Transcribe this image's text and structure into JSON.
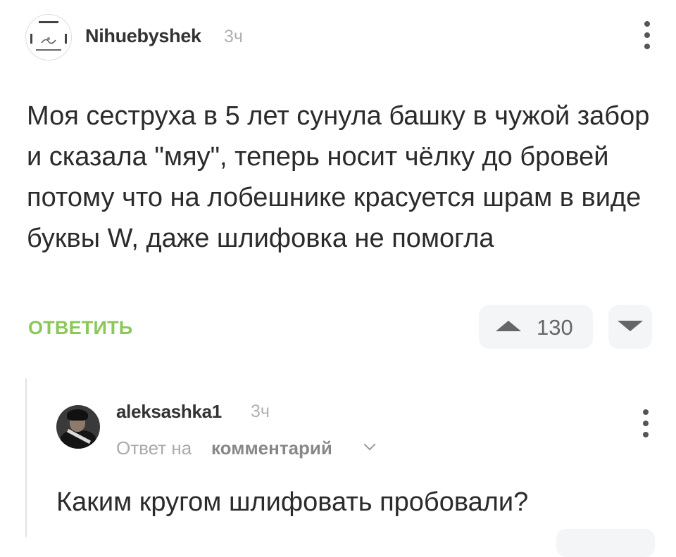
{
  "comment": {
    "username": "Nihuebyshek",
    "time": "3ч",
    "text": "Моя сеструха в 5 лет сунула башку в чужой забор и сказала \"мяу\", теперь носит чёлку до бровей потому что на лобешнике красуется шрам в виде буквы W, даже шлифовка не помогла",
    "reply_label": "ОТВЕТИТЬ",
    "rating": "130"
  },
  "reply": {
    "username": "aleksashka1",
    "time": "3ч",
    "reply_to_prefix": "Ответ на",
    "reply_to_link": "комментарий",
    "text": "Каким кругом шлифовать пробовали?"
  },
  "colors": {
    "accent_reply": "#8ac858",
    "vote_bg": "#f4f5f7",
    "muted": "#b0b0b0"
  },
  "icons": {
    "more": "more-vertical-icon",
    "upvote": "upvote-triangle-icon",
    "downvote": "downvote-triangle-icon",
    "expand": "chevron-down-icon"
  }
}
